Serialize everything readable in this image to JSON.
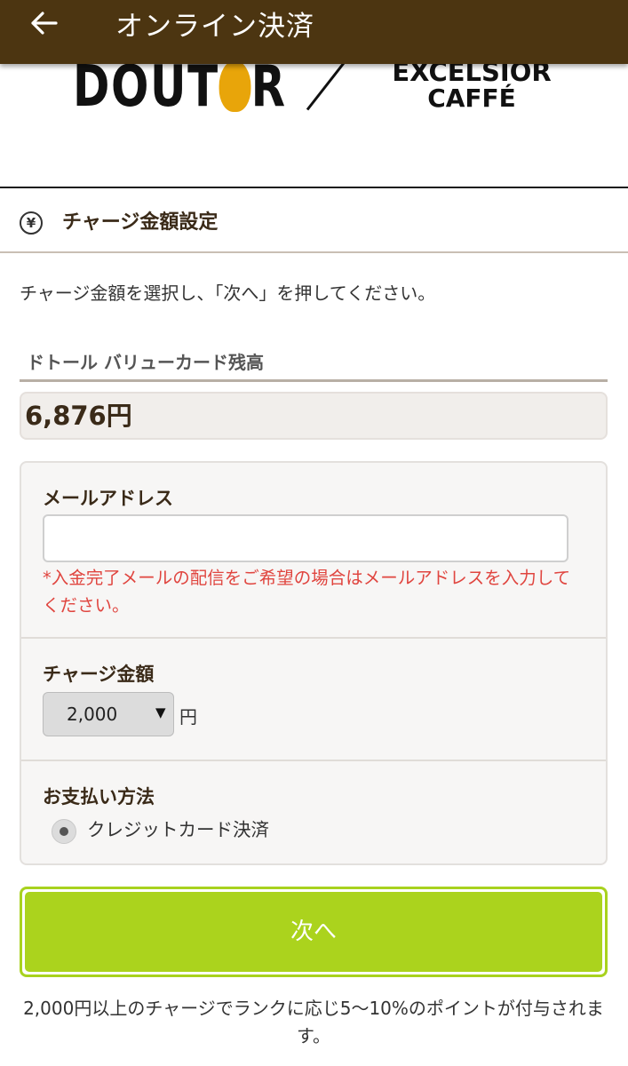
{
  "appbar": {
    "title": "オンライン決済",
    "background": "#4c3511"
  },
  "logos": {
    "doutor_prefix": "DOUT",
    "doutor_suffix": "R",
    "excelsior_line1": "EXCELSIOR",
    "excelsior_line2": "CAFFÉ"
  },
  "section": {
    "icon": "yen-circle-icon",
    "title": "チャージ金額設定"
  },
  "instruction": "チャージ金額を選択し、「次へ」を押してください。",
  "balance": {
    "label": "ドトール バリューカード残高",
    "value": "6,876円"
  },
  "form": {
    "email": {
      "label": "メールアドレス",
      "value": "",
      "note": "*入金完了メールの配信をご希望の場合はメールアドレスを入力してください。"
    },
    "amount": {
      "label": "チャージ金額",
      "selected": "2,000",
      "unit": "円"
    },
    "payment": {
      "label": "お支払い方法",
      "option": "クレジットカード決済"
    }
  },
  "next_button": {
    "label": "次へ",
    "color": "#abd31d"
  },
  "footer_note": "2,000円以上のチャージでランクに応じ5〜10%のポイントが付与されます。"
}
